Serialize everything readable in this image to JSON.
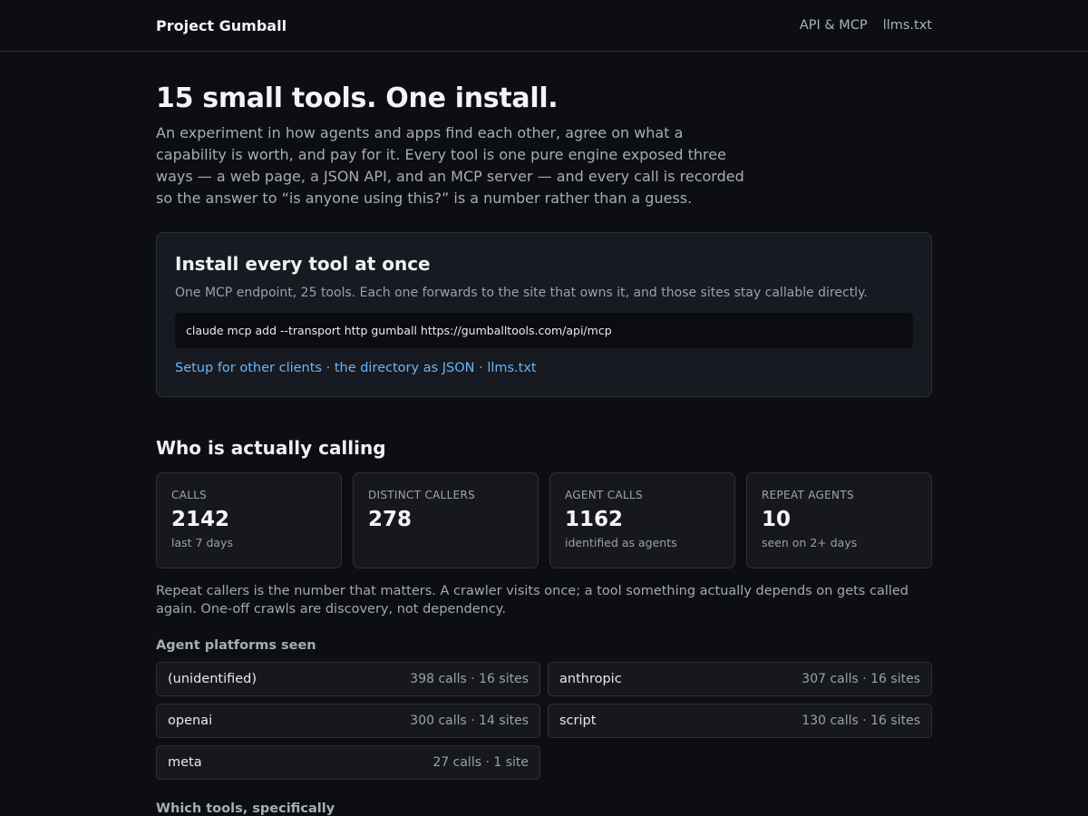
{
  "header": {
    "brand": "Project Gumball",
    "nav": [
      {
        "label": "API & MCP"
      },
      {
        "label": "llms.txt"
      }
    ]
  },
  "hero": {
    "title": "15 small tools. One install.",
    "description": "An experiment in how agents and apps find each other, agree on what a capability is worth, and pay for it. Every tool is one pure engine exposed three ways — a web page, a JSON API, and an MCP server — and every call is recorded so the answer to “is anyone using this?” is a number rather than a guess."
  },
  "install": {
    "title": "Install every tool at once",
    "subtitle": "One MCP endpoint, 25 tools. Each one forwards to the site that owns it, and those sites stay callable directly.",
    "command": "claude mcp add --transport http gumball https://gumballtools.com/api/mcp",
    "links": [
      {
        "label": "Setup for other clients"
      },
      {
        "label": "the directory as JSON"
      },
      {
        "label": "llms.txt"
      }
    ],
    "separator": " · "
  },
  "calling": {
    "title": "Who is actually calling",
    "stats": [
      {
        "label": "CALLS",
        "value": "2142",
        "note": "last 7 days"
      },
      {
        "label": "DISTINCT CALLERS",
        "value": "278",
        "note": ""
      },
      {
        "label": "AGENT CALLS",
        "value": "1162",
        "note": "identified as agents"
      },
      {
        "label": "REPEAT AGENTS",
        "value": "10",
        "note": "seen on 2+ days"
      }
    ],
    "explanation": "Repeat callers is the number that matters. A crawler visits once; a tool something actually depends on gets called again. One-off crawls are discovery, not dependency.",
    "platforms_heading": "Agent platforms seen",
    "platforms": [
      {
        "name": "(unidentified)",
        "meta": "398 calls · 16 sites"
      },
      {
        "name": "anthropic",
        "meta": "307 calls · 16 sites"
      },
      {
        "name": "openai",
        "meta": "300 calls · 14 sites"
      },
      {
        "name": "script",
        "meta": "130 calls · 16 sites"
      },
      {
        "name": "meta",
        "meta": "27 calls · 1 site"
      }
    ],
    "tools_heading": "Which tools, specifically"
  },
  "colors": {
    "background": "#0d0e11",
    "card": "#16181d",
    "border": "#2c313a",
    "link": "#6cb4f5"
  }
}
